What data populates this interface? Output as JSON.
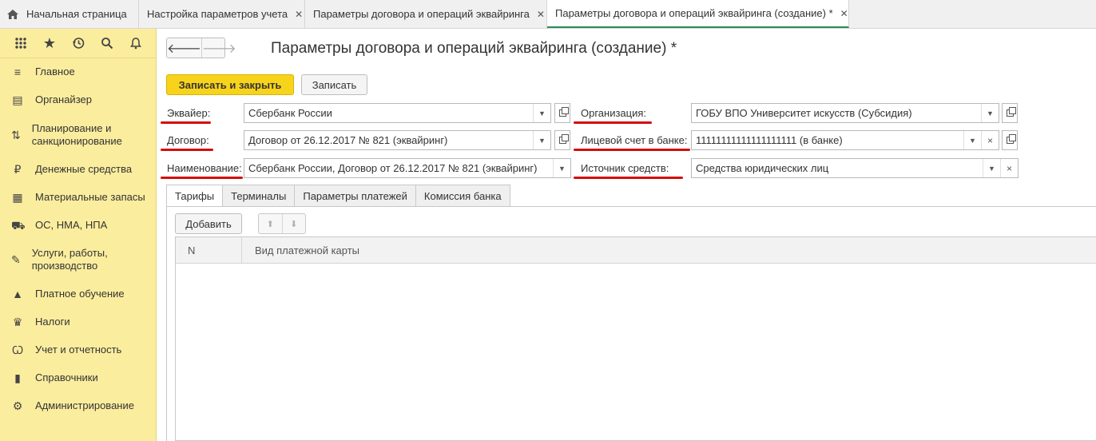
{
  "tabs": {
    "home": "Начальная страница",
    "items": [
      {
        "label": "Настройка параметров учета",
        "close": "✕"
      },
      {
        "label": "Параметры договора и операций эквайринга",
        "close": "✕"
      },
      {
        "label": "Параметры договора и операций эквайринга (создание) *",
        "close": "✕"
      }
    ]
  },
  "sidebar": {
    "items": [
      {
        "label": "Главное",
        "icon": "menu-icon"
      },
      {
        "label": "Органайзер",
        "icon": "clipboard-icon"
      },
      {
        "label": "Планирование и санкционирование",
        "icon": "planning-icon"
      },
      {
        "label": "Денежные средства",
        "icon": "ruble-icon"
      },
      {
        "label": "Материальные запасы",
        "icon": "grid-icon"
      },
      {
        "label": "ОС, НМА, НПА",
        "icon": "truck-icon"
      },
      {
        "label": "Услуги, работы, производство",
        "icon": "tools-icon"
      },
      {
        "label": "Платное обучение",
        "icon": "graduation-cap-icon"
      },
      {
        "label": "Налоги",
        "icon": "emblem-icon"
      },
      {
        "label": "Учет и отчетность",
        "icon": "accounting-icon"
      },
      {
        "label": "Справочники",
        "icon": "books-icon"
      },
      {
        "label": "Администрирование",
        "icon": "gear-icon"
      }
    ]
  },
  "form": {
    "title": "Параметры договора и операций эквайринга (создание) *",
    "save_close_label": "Записать и закрыть",
    "save_label": "Записать",
    "acquirer_label": "Эквайер:",
    "acquirer_value": "Сбербанк России",
    "organization_label": "Организация:",
    "organization_value": "ГОБУ ВПО Университет искусств (Субсидия)",
    "contract_label": "Договор:",
    "contract_value": "Договор от 26.12.2017 № 821 (эквайринг)",
    "account_label": "Лицевой счет в банке:",
    "account_value": "11111111111111111111 (в банке)",
    "name_label": "Наименование:",
    "name_value": "Сбербанк России, Договор от 26.12.2017 № 821 (эквайринг)",
    "source_label": "Источник средств:",
    "source_value": "Средства юридических лиц"
  },
  "inner_tabs": [
    "Тарифы",
    "Терминалы",
    "Параметры платежей",
    "Комиссия банка"
  ],
  "table": {
    "add_label": "Добавить",
    "columns": [
      "N",
      "Вид платежной карты"
    ]
  },
  "colors": {
    "accent_yellow": "#f8d31b",
    "sidebar_bg": "#fbed9e",
    "highlight_red": "#d40d0d",
    "active_tab_green": "#2e8b57"
  }
}
